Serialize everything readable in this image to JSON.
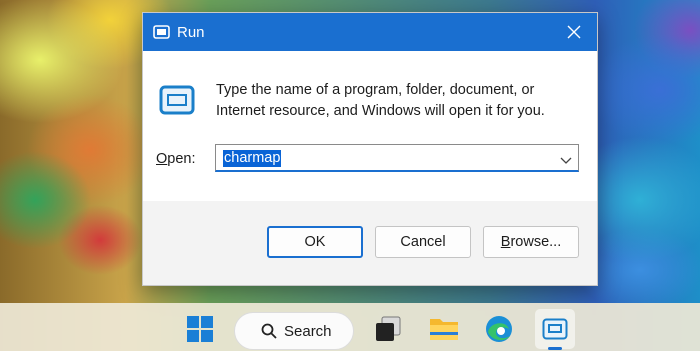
{
  "dialog": {
    "title": "Run",
    "message_line1": "Type the name of a program, folder, document, or",
    "message_line2": "Internet resource, and Windows will open it for you.",
    "open_label_prefix": "O",
    "open_label_rest": "pen:",
    "open_value": "charmap",
    "ok_label": "OK",
    "cancel_label": "Cancel",
    "browse_label_prefix": "B",
    "browse_label_rest": "rowse..."
  },
  "taskbar": {
    "search_label": "Search",
    "items": [
      "start-icon",
      "search",
      "task-view-icon",
      "file-explorer-icon",
      "edge-icon",
      "run-icon"
    ]
  },
  "colors": {
    "accent": "#1a6fd0",
    "dialog_bg": "#f3f3f3",
    "selection": "#0a64d6"
  }
}
